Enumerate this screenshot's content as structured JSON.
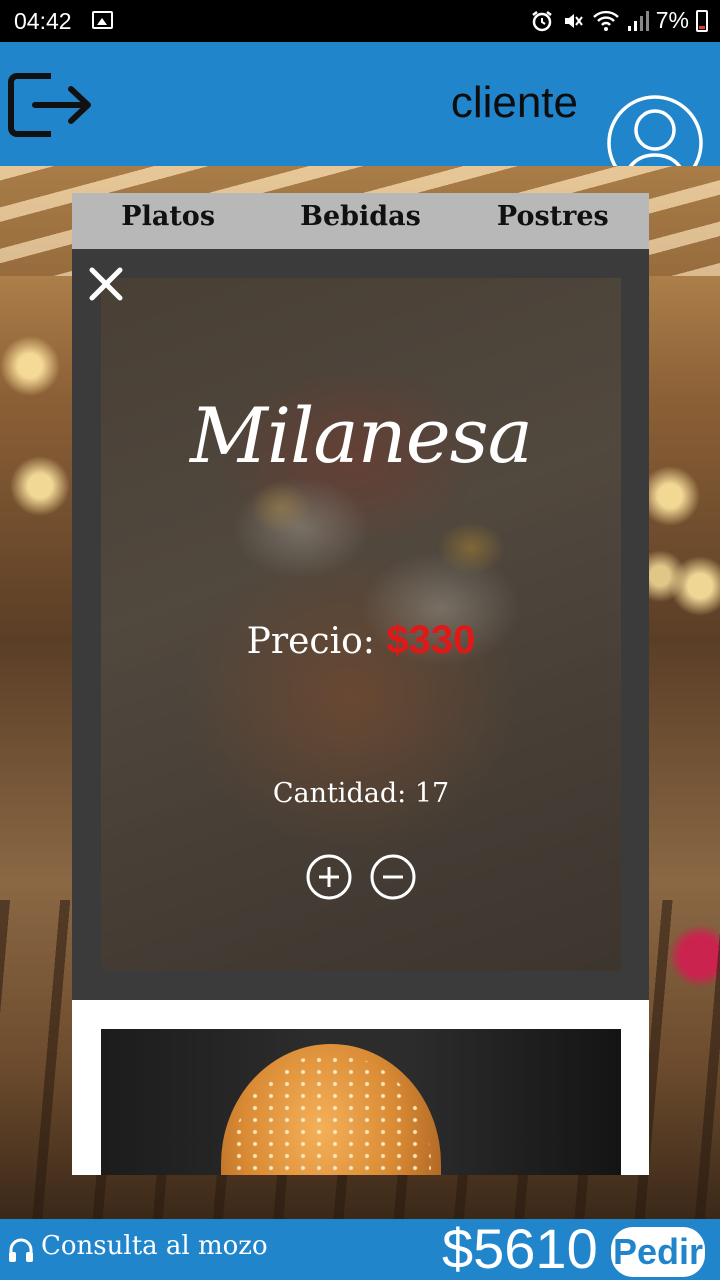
{
  "status_bar": {
    "time": "04:42",
    "battery": "7%",
    "icons": [
      "image-icon",
      "alarm-icon",
      "mute-icon",
      "wifi-icon",
      "signal-icon",
      "battery-icon"
    ]
  },
  "header": {
    "user_label": "cliente",
    "logout_icon": "logout-icon",
    "avatar_icon": "user-avatar-icon",
    "background_color": "#2185cc"
  },
  "menu": {
    "tabs": [
      {
        "label": "Platos"
      },
      {
        "label": "Bebidas"
      },
      {
        "label": "Postres"
      }
    ],
    "item": {
      "name": "Milanesa",
      "price_label": "Precio:",
      "price_value": "$330",
      "quantity_label": "Cantidad:",
      "quantity_value": "17",
      "price_color": "#e01818"
    }
  },
  "bottom_bar": {
    "waiter_label": "Consulta al mozo",
    "total": "$5610",
    "order_button": "Pedir"
  }
}
